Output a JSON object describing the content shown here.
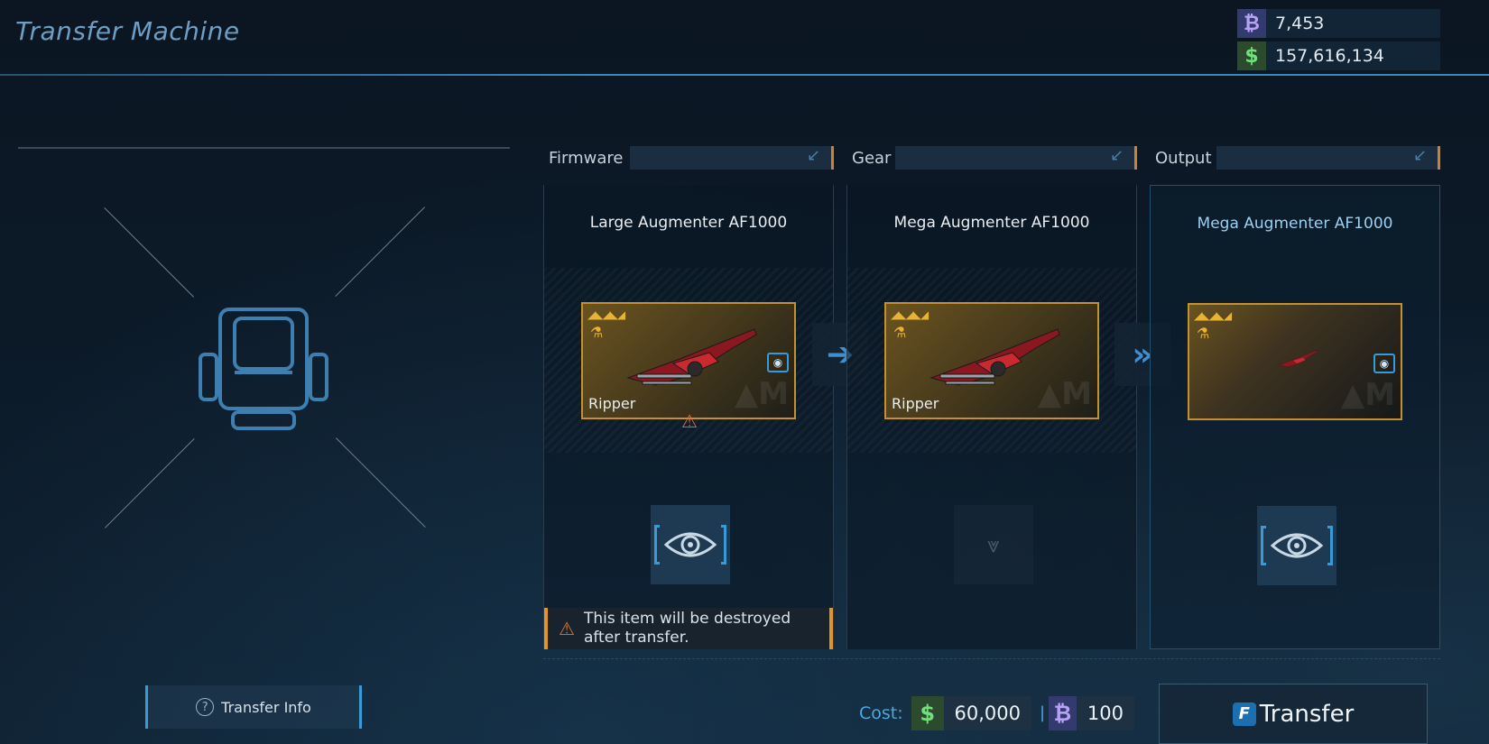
{
  "header": {
    "title": "Transfer Machine"
  },
  "wallet": {
    "credits": {
      "icon": "credits-icon",
      "value": "7,453"
    },
    "money": {
      "icon": "dollar-icon",
      "value": "157,616,134"
    }
  },
  "columns": [
    {
      "header": "Firmware",
      "item_title": "Large Augmenter AF1000",
      "card_name": "Ripper",
      "warning": "This item will be destroyed after transfer."
    },
    {
      "header": "Gear",
      "item_title": "Mega Augmenter AF1000",
      "card_name": "Ripper"
    },
    {
      "header": "Output",
      "item_title": "Mega Augmenter AF1000"
    }
  ],
  "footer": {
    "transfer_info": "Transfer Info",
    "cost_label": "Cost:",
    "cost_money": "60,000",
    "cost_separator": "|",
    "cost_credits": "100",
    "transfer_key": "F",
    "transfer_label": "Transfer"
  },
  "colors": {
    "accent": "#3a9ad6",
    "rarity": "#c4912e",
    "warning": "#e0742a"
  }
}
